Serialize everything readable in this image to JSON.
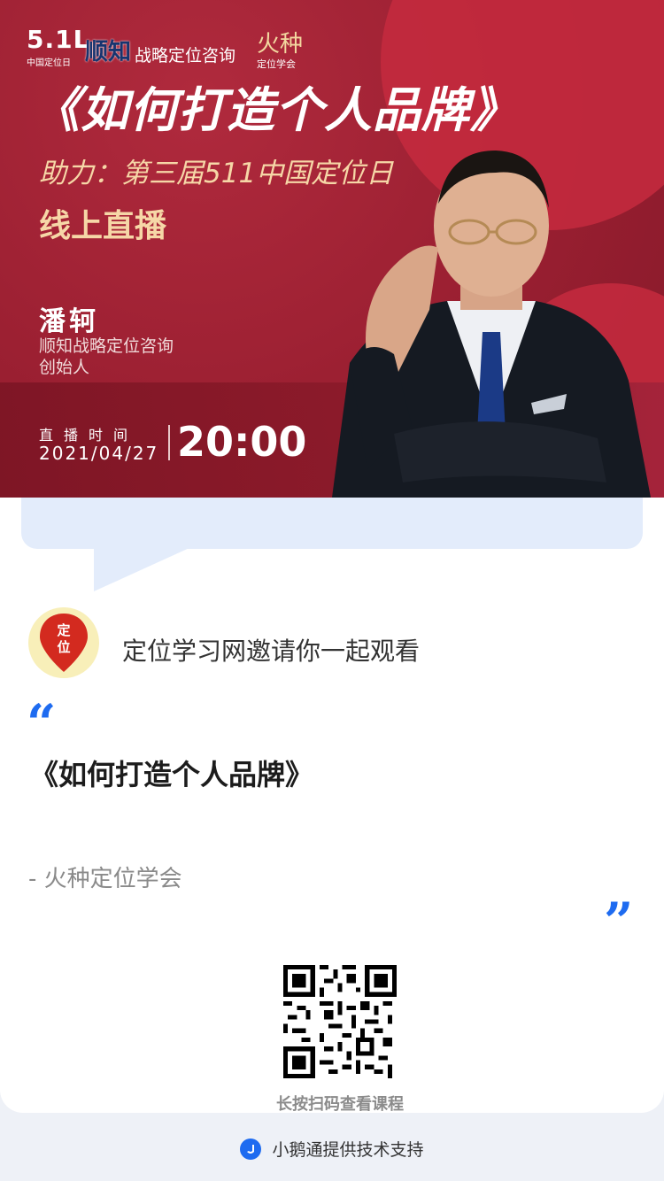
{
  "banner": {
    "logo_511": "5.1L",
    "logo_511_sub": "中国定位日",
    "brand_shunzhi": "顺知",
    "brand_shunzhi_sub": "战略定位咨询",
    "brand_huozhong": "火种",
    "brand_huozhong_sub": "定位学会",
    "title": "《如何打造个人品牌》",
    "subtitle": "助力：第三届511中国定位日",
    "live_label": "线上直播",
    "speaker": {
      "name": "潘轲",
      "org": "顺知战略定位咨询",
      "role": "创始人"
    },
    "time_label": "直播时间",
    "date": "2021/04/27",
    "time": "20:00"
  },
  "card": {
    "avatar_text": "定位",
    "invite_text": "定位学习网邀请你一起观看",
    "quote_open": "“",
    "quote_close": "”",
    "course_title": "《如何打造个人品牌》",
    "author": "- 火种定位学会",
    "qr_caption": "长按扫码查看课程"
  },
  "footer": {
    "text": "小鹅通提供技术支持"
  },
  "colors": {
    "banner_red": "#9a1f31",
    "accent_blue": "#1e6bf0",
    "gold": "#f6d7a7",
    "bubble": "#e3ecfb"
  }
}
